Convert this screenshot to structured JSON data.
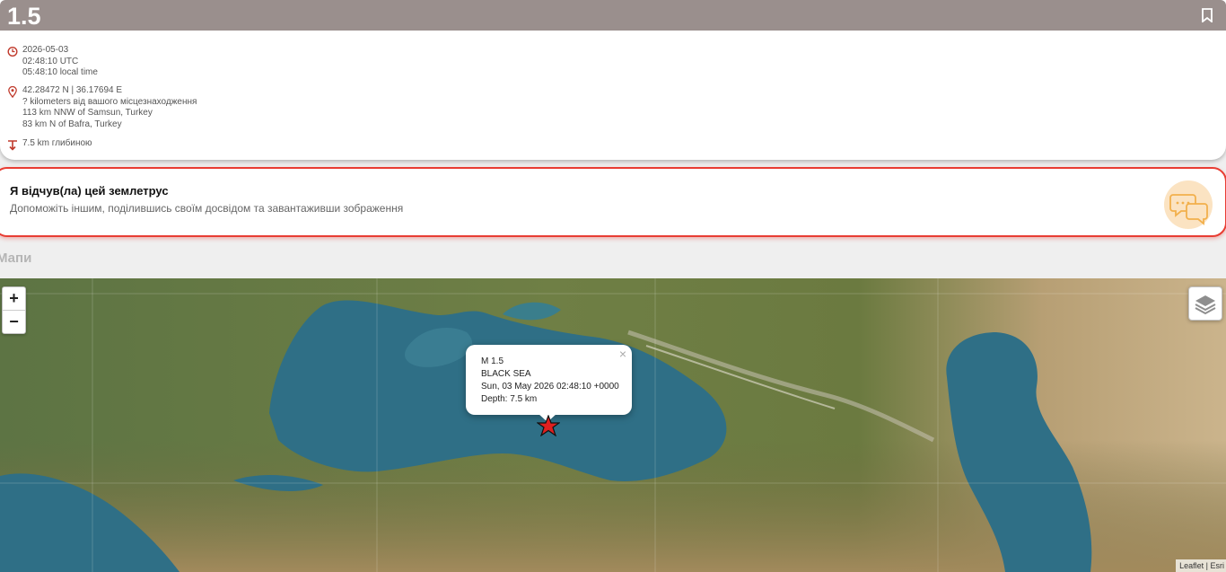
{
  "event": {
    "magnitude": "1.5",
    "date": "2026-05-03",
    "utc_time": "02:48:10 UTC",
    "local_time": "05:48:10 local time",
    "coords": "42.28472 N | 36.17694 E",
    "distance_from_you": "? kilometers від вашого місцезнаходження",
    "near_1": "113 km NNW of Samsun, Turkey",
    "near_2": "83 km N of Bafra, Turkey",
    "depth": "7.5 km глибиною"
  },
  "felt": {
    "title": "Я відчув(ла) цей землетрус",
    "subtitle": "Допоможіть іншим, поділившись своїм досвідом та завантаживши зображення"
  },
  "maps_title": "Мапи",
  "map": {
    "zoom_in": "+",
    "zoom_out": "−",
    "popup": {
      "close": "×",
      "line1": "M 1.5",
      "line2": "BLACK SEA",
      "line3": "Sun, 03 May 2026 02:48:10 +0000",
      "line4": "Depth: 7.5 km"
    },
    "attribution": "Leaflet | Esri"
  },
  "icons": {
    "time": "clock-icon",
    "location": "map-pin-icon",
    "depth": "depth-arrow-icon",
    "bookmark": "bookmark-icon",
    "felt": "chat-bubbles-icon",
    "layers": "layers-icon",
    "epicenter": "star-marker-icon"
  },
  "colors": {
    "header": "#9a8f8d",
    "accent": "#e83d33",
    "icon": "#c0392b"
  }
}
